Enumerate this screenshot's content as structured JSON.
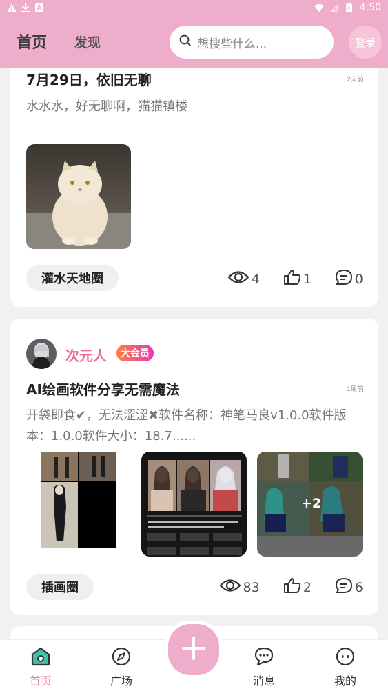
{
  "status_bar": {
    "time": "4:50"
  },
  "header": {
    "tab_home": "首页",
    "tab_discover": "发现",
    "search_placeholder": "想搜些什么...",
    "login_label": "登录"
  },
  "posts": [
    {
      "title": "7月29日，依旧无聊",
      "time": "2天前",
      "body": "水水水，好无聊啊，猫猫镇楼",
      "circle": "灌水天地圈",
      "views": "4",
      "likes": "1",
      "comments": "0"
    },
    {
      "author": "次元人",
      "badge": "大会员",
      "title": "AI绘画软件分享无需魔法",
      "time": "1周前",
      "body": "开袋即食✔，无法涩涩✖软件名称：神笔马良v1.0.0软件版本：1.0.0软件大小：18.7......",
      "image_more": "+2",
      "circle": "插画圈",
      "views": "83",
      "likes": "2",
      "comments": "6"
    }
  ],
  "bottom_nav": {
    "home": "首页",
    "square": "广场",
    "messages": "消息",
    "mine": "我的"
  },
  "colors": {
    "accent": "#eeadcb",
    "active": "#ef87b3",
    "username": "#f06aa1"
  }
}
